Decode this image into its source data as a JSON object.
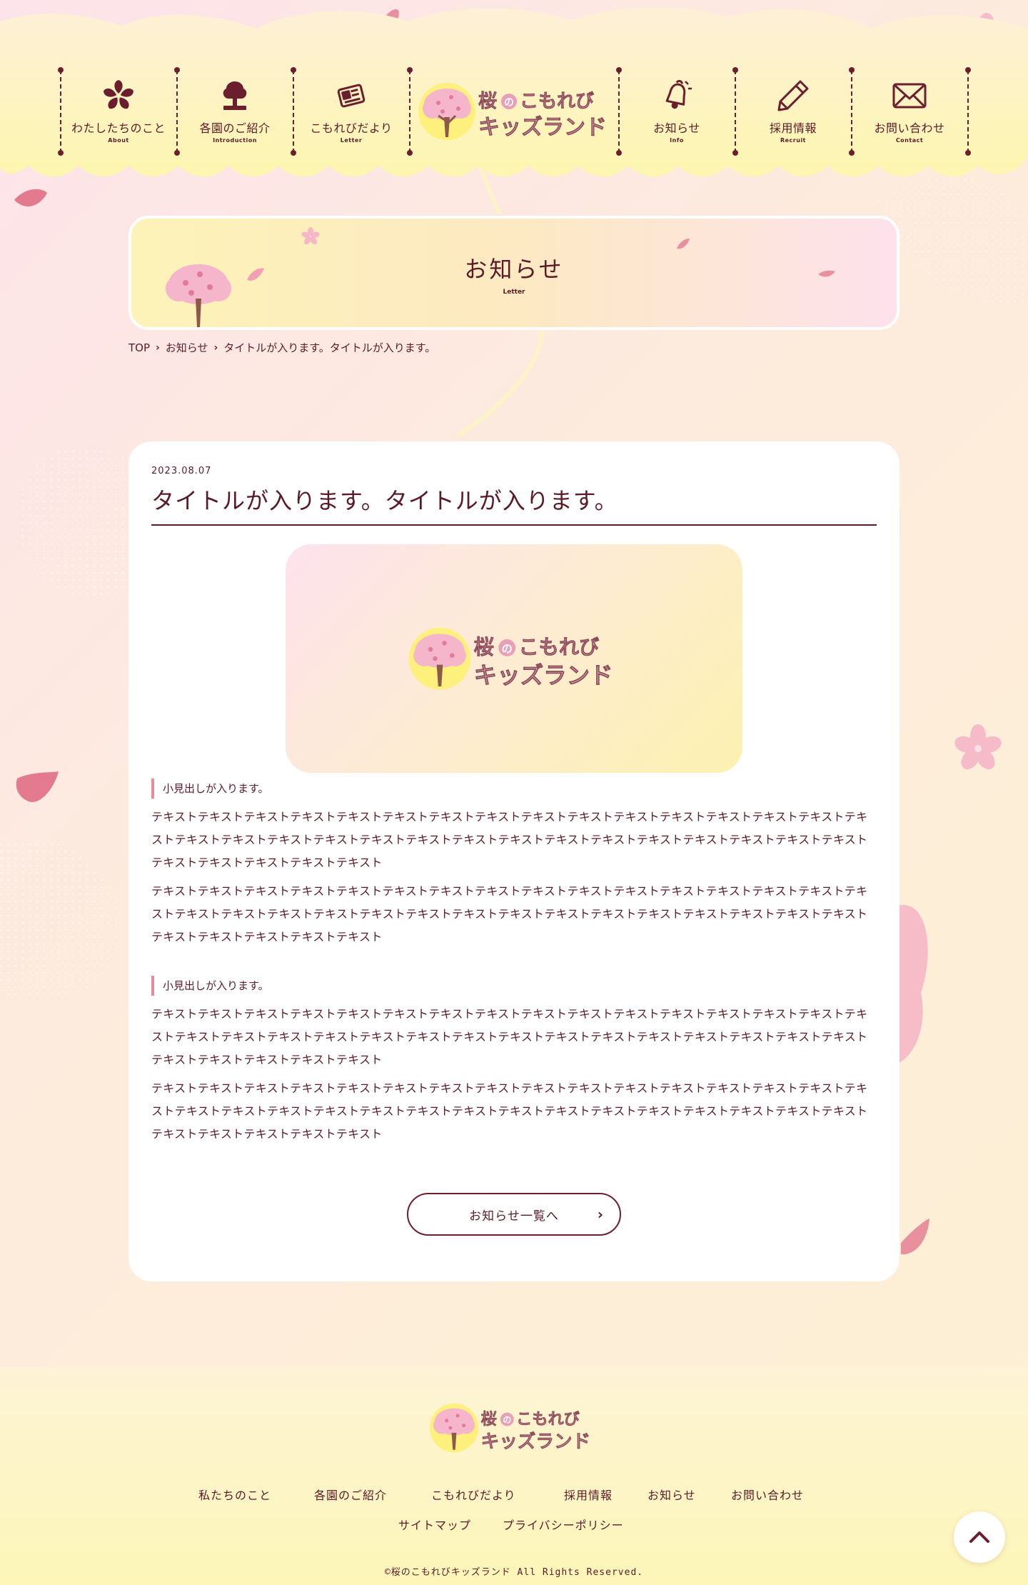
{
  "nav": {
    "items": [
      {
        "label": "わたしたちのこと",
        "sub": "About",
        "icon": "sakura-flower-icon"
      },
      {
        "label": "各園のご紹介",
        "sub": "Introduction",
        "icon": "tree-icon"
      },
      {
        "label": "こもれびだより",
        "sub": "Letter",
        "icon": "newspaper-icon"
      },
      {
        "label": "お知らせ",
        "sub": "Info",
        "icon": "bell-icon"
      },
      {
        "label": "採用情報",
        "sub": "Recruit",
        "icon": "pencil-icon"
      },
      {
        "label": "お問い合わせ",
        "sub": "Contact",
        "icon": "envelope-icon"
      }
    ]
  },
  "logo": {
    "line1_a": "桜",
    "line1_b": "の",
    "line1_c": "こもれび",
    "line2": "キッズランド"
  },
  "banner": {
    "title": "お知らせ",
    "sub": "Letter"
  },
  "breadcrumb": {
    "home": "TOP",
    "section": "お知らせ",
    "current": "タイトルが入ります。タイトルが入ります。"
  },
  "article": {
    "date": "2023.08.07",
    "title": "タイトルが入ります。タイトルが入ります。",
    "sections": [
      {
        "heading": "小見出しが入ります。",
        "paragraphs": [
          "テキストテキストテキストテキストテキストテキストテキストテキストテキストテキストテキストテキストテキストテキストテキストテキストテキストテキストテキストテキストテキストテキストテキストテキストテキストテキストテキストテキストテキストテキストテキストテキストテキストテキストテキストテキスト",
          "テキストテキストテキストテキストテキストテキストテキストテキストテキストテキストテキストテキストテキストテキストテキストテキストテキストテキストテキストテキストテキストテキストテキストテキストテキストテキストテキストテキストテキストテキストテキストテキストテキストテキストテキストテキスト"
        ]
      },
      {
        "heading": "小見出しが入ります。",
        "paragraphs": [
          "テキストテキストテキストテキストテキストテキストテキストテキストテキストテキストテキストテキストテキストテキストテキストテキストテキストテキストテキストテキストテキストテキストテキストテキストテキストテキストテキストテキストテキストテキストテキストテキストテキストテキストテキストテキスト",
          "テキストテキストテキストテキストテキストテキストテキストテキストテキストテキストテキストテキストテキストテキストテキストテキストテキストテキストテキストテキストテキストテキストテキストテキストテキストテキストテキストテキストテキストテキストテキストテキストテキストテキストテキストテキスト"
        ]
      }
    ],
    "back_button": "お知らせ一覧へ"
  },
  "footer": {
    "links_row1": [
      "私たちのこと",
      "各園のご紹介",
      "こもれびだより",
      "採用情報",
      "お知らせ",
      "お問い合わせ"
    ],
    "links_row2": [
      "サイトマップ",
      "プライバシーポリシー"
    ],
    "copyright": "©桜のこもれびキッズランド All Rights Reserved."
  },
  "colors": {
    "text": "#5a1a28",
    "accent_pink": "#e98a9a",
    "header_yellow": "#fdf6b8",
    "card_bg": "#ffffff"
  }
}
